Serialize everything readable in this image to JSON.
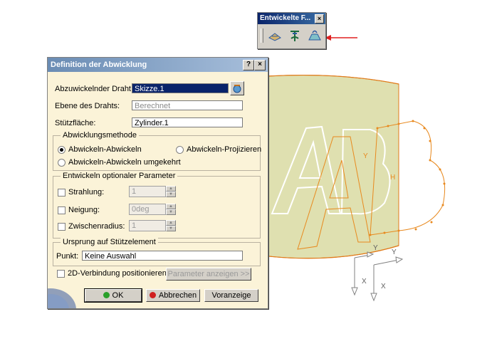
{
  "toolbar": {
    "title": "Entwickelte F...",
    "close_label": "×",
    "tools": [
      "unfold-icon",
      "develop-icon",
      "transfer-icon"
    ]
  },
  "dialog": {
    "title": "Definition der Abwicklung",
    "help_label": "?",
    "close_label": "×",
    "wire_label": "Abzuwickelnder Draht:",
    "wire_value": "Skizze.1",
    "plane_label": "Ebene des Drahts:",
    "plane_value": "Berechnet",
    "support_label": "Stützfläche:",
    "support_value": "Zylinder.1",
    "method": {
      "title": "Abwicklungsmethode",
      "options": [
        "Abwickeln-Abwickeln",
        "Abwickeln-Projizieren",
        "Abwickeln-Abwickeln umgekehrt"
      ],
      "selected": "Abwickeln-Abwickeln"
    },
    "optional": {
      "title": "Entwickeln optionaler Parameter",
      "radiation_label": "Strahlung:",
      "radiation_value": "1",
      "inclination_label": "Neigung:",
      "inclination_value": "0deg",
      "radius_label": "Zwischenradius:",
      "radius_value": "1"
    },
    "origin": {
      "title": "Ursprung auf Stützelement",
      "point_label": "Punkt:",
      "point_value": "Keine Auswahl"
    },
    "position_2d_label": "2D-Verbindung positionieren",
    "show_params_label": "Parameter anzeigen >>",
    "ok_label": "OK",
    "cancel_label": "Abbrechen",
    "preview_label": "Voranzeige"
  },
  "viewport": {
    "letters_white": "AB",
    "letters_orange": "AB",
    "axis_x": "X",
    "axis_y": "Y",
    "axis_h": "H"
  },
  "colors": {
    "cylinder": "#dfe0b0",
    "cylinder_edge": "#e07a1a",
    "orange_curve": "#e8891e",
    "arrow": "#e02020",
    "ok_dot": "#2aa02a",
    "cancel_dot": "#d02020"
  }
}
